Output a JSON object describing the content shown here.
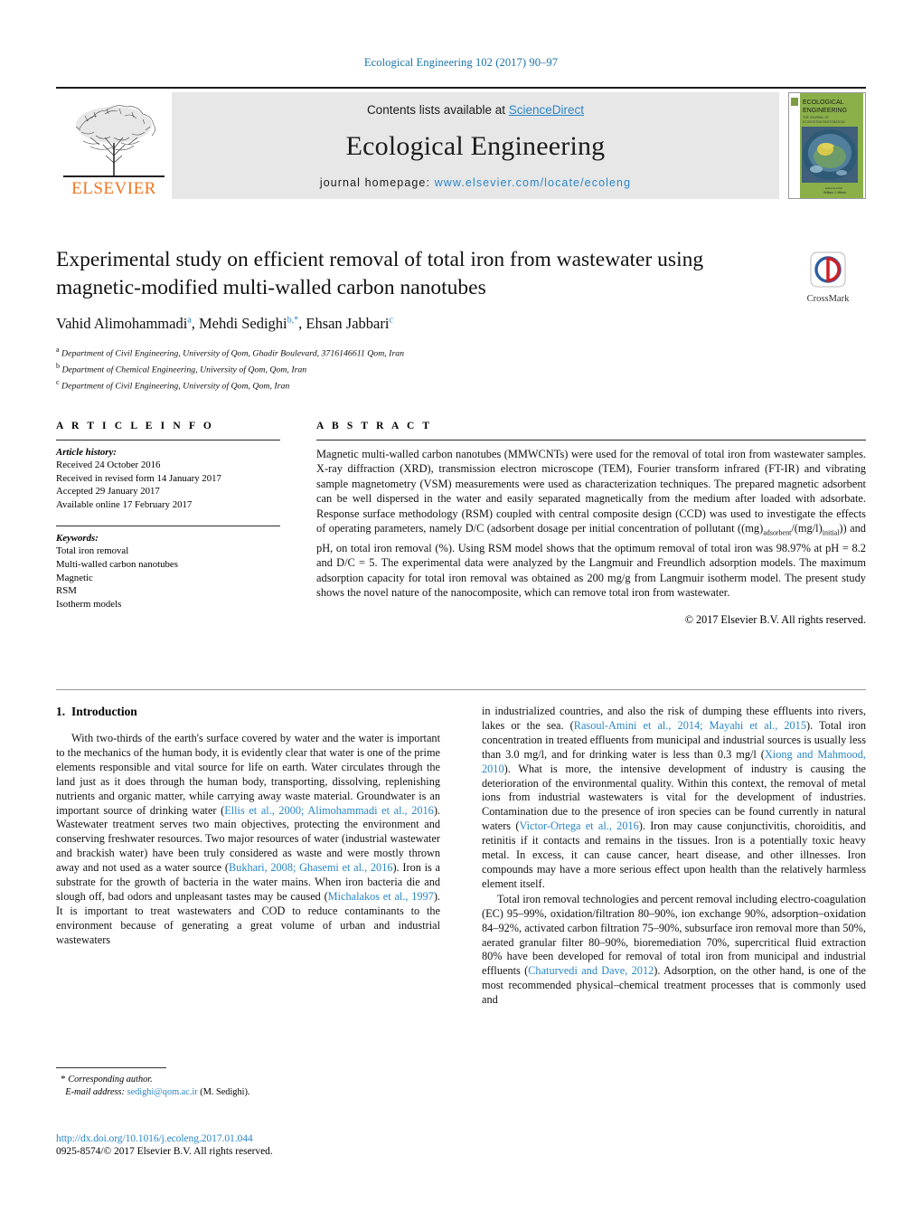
{
  "running_head": "Ecological Engineering 102 (2017) 90–97",
  "masthead": {
    "contents_prefix": "Contents lists available at ",
    "contents_link": "ScienceDirect",
    "journal_title": "Ecological Engineering",
    "homepage_prefix": "journal homepage: ",
    "homepage_url": "www.elsevier.com/locate/ecoleng",
    "publisher": "ELSEVIER",
    "cover": {
      "line1": "ECOLOGICAL",
      "line2": "ENGINEERING",
      "line3": "THE JOURNAL OF",
      "line4": "ECOSYSTEM RESTORATION",
      "footer1": "Editor-in-Chief",
      "footer2": "William J. Mitsch"
    }
  },
  "article": {
    "title": "Experimental study on efficient removal of total iron from wastewater using magnetic-modified multi-walled carbon nanotubes",
    "authors": [
      {
        "name": "Vahid Alimohammadi",
        "marks": "a",
        "sep": ", "
      },
      {
        "name": "Mehdi Sedighi",
        "marks": "b,*",
        "sep": ", "
      },
      {
        "name": "Ehsan Jabbari",
        "marks": "c",
        "sep": ""
      }
    ],
    "affiliations": [
      {
        "mark": "a",
        "text": "Department of Civil Engineering, University of Qom, Ghadir Boulevard, 3716146611 Qom, Iran"
      },
      {
        "mark": "b",
        "text": "Department of Chemical Engineering, University of Qom, Qom, Iran"
      },
      {
        "mark": "c",
        "text": "Department of Civil Engineering, University of Qom, Qom, Iran"
      }
    ],
    "crossmark_label": "CrossMark"
  },
  "info": {
    "heading": "A R T I C L E    I N F O",
    "history_label": "Article history:",
    "history": [
      "Received 24 October 2016",
      "Received in revised form 14 January 2017",
      "Accepted 29 January 2017",
      "Available online 17 February 2017"
    ],
    "keywords_label": "Keywords:",
    "keywords": [
      "Total iron removal",
      "Multi-walled carbon nanotubes",
      "Magnetic",
      "RSM",
      "Isotherm models"
    ]
  },
  "abstract": {
    "heading": "A B S T R A C T",
    "part1": "Magnetic multi-walled carbon nanotubes (MMWCNTs) were used for the removal of total iron from wastewater samples. X-ray diffraction (XRD), transmission electron microscope (TEM), Fourier transform infrared (FT-IR) and vibrating sample magnetometry (VSM) measurements were used as characterization techniques. The prepared magnetic adsorbent can be well dispersed in the water and easily separated magnetically from the medium after loaded with adsorbate. Response surface methodology (RSM) coupled with central composite design (CCD) was used to investigate the effects of operating parameters, namely D/C (adsorbent dosage per initial concentration of pollutant ((mg)",
    "sub1": "adsorbent",
    "part2": "/(mg/l)",
    "sub2": "initial",
    "part3": ")) and pH, on total iron removal (%). Using RSM model shows that the optimum removal of total iron was 98.97% at pH = 8.2 and D/C = 5. The experimental data were analyzed by the Langmuir and Freundlich adsorption models. The maximum adsorption capacity for total iron removal was obtained as 200 mg/g from Langmuir isotherm model. The present study shows the novel nature of the nanocomposite, which can remove total iron from wastewater.",
    "copyright": "© 2017 Elsevier B.V. All rights reserved."
  },
  "intro": {
    "number": "1.",
    "title": "Introduction",
    "left_p1_a": "With two-thirds of the earth's surface covered by water and the water is important to the mechanics of the human body, it is evidently clear that water is one of the prime elements responsible and vital source for life on earth. Water circulates through the land just as it does through the human body, transporting, dissolving, replenishing nutrients and organic matter, while carrying away waste material. Groundwater is an important source of drinking water (",
    "left_p1_ref1": "Ellis et al., 2000; Alimohammadi et al., 2016",
    "left_p1_b": "). Wastewater treatment serves two main objectives, protecting the environment and conserving freshwater resources. Two major resources of water (industrial wastewater and brackish water) have been truly considered as waste and were mostly thrown away and not used as a water source (",
    "left_p1_ref2": "Bukhari, 2008; Ghasemi et al., 2016",
    "left_p1_c": "). Iron is a substrate for the growth of bacteria in the water mains. When iron bacteria die and slough off, bad odors and unpleasant tastes may be caused (",
    "left_p1_ref3": "Michalakos et al., 1997",
    "left_p1_d": "). It is important to treat wastewaters and COD to reduce contaminants to the environment because of generating a great volume of urban and industrial wastewaters",
    "right_p1_a": "in industrialized countries, and also the risk of dumping these effluents into rivers, lakes or the sea. (",
    "right_p1_ref1": "Rasoul-Amini et al., 2014; Mayahi et al., 2015",
    "right_p1_b": "). Total iron concentration in treated effluents from municipal and industrial sources is usually less than 3.0 mg/l, and for drinking water is less than 0.3 mg/l (",
    "right_p1_ref2": "Xiong and Mahmood, 2010",
    "right_p1_c": "). What is more, the intensive development of industry is causing the deterioration of the environmental quality. Within this context, the removal of metal ions from industrial wastewaters is vital for the development of industries. Contamination due to the presence of iron species can be found currently in natural waters (",
    "right_p1_ref3": "Victor-Ortega et al., 2016",
    "right_p1_d": "). Iron may cause conjunctivitis, choroiditis, and retinitis if it contacts and remains in the tissues. Iron is a potentially toxic heavy metal. In excess, it can cause cancer, heart disease, and other illnesses. Iron compounds may have a more serious effect upon health than the relatively harmless element itself.",
    "right_p2_a": "Total iron removal technologies and percent removal including electro-coagulation (EC) 95–99%, oxidation/filtration 80–90%, ion exchange 90%, adsorption–oxidation 84–92%, activated carbon filtration 75–90%, subsurface iron removal more than 50%, aerated granular filter 80–90%, bioremediation 70%, supercritical fluid extraction 80% have been developed for removal of total iron from municipal and industrial effluents (",
    "right_p2_ref1": "Chaturvedi and Dave, 2012",
    "right_p2_b": "). Adsorption, on the other hand, is one of the most recommended physical–chemical treatment processes that is commonly used and"
  },
  "footnote": {
    "star": "*",
    "corresponding": "Corresponding author.",
    "email_label": "E-mail address:",
    "email": "sedighi@qom.ac.ir",
    "email_suffix": "(M. Sedighi)."
  },
  "footer": {
    "doi": "http://dx.doi.org/10.1016/j.ecoleng.2017.01.044",
    "issn": "0925-8574/© 2017 Elsevier B.V. All rights reserved."
  },
  "colors": {
    "link": "#2a86c8",
    "running_head": "#1a73a7",
    "elsevier_orange": "#ef7622",
    "masthead_bg": "#e7e7e7"
  }
}
